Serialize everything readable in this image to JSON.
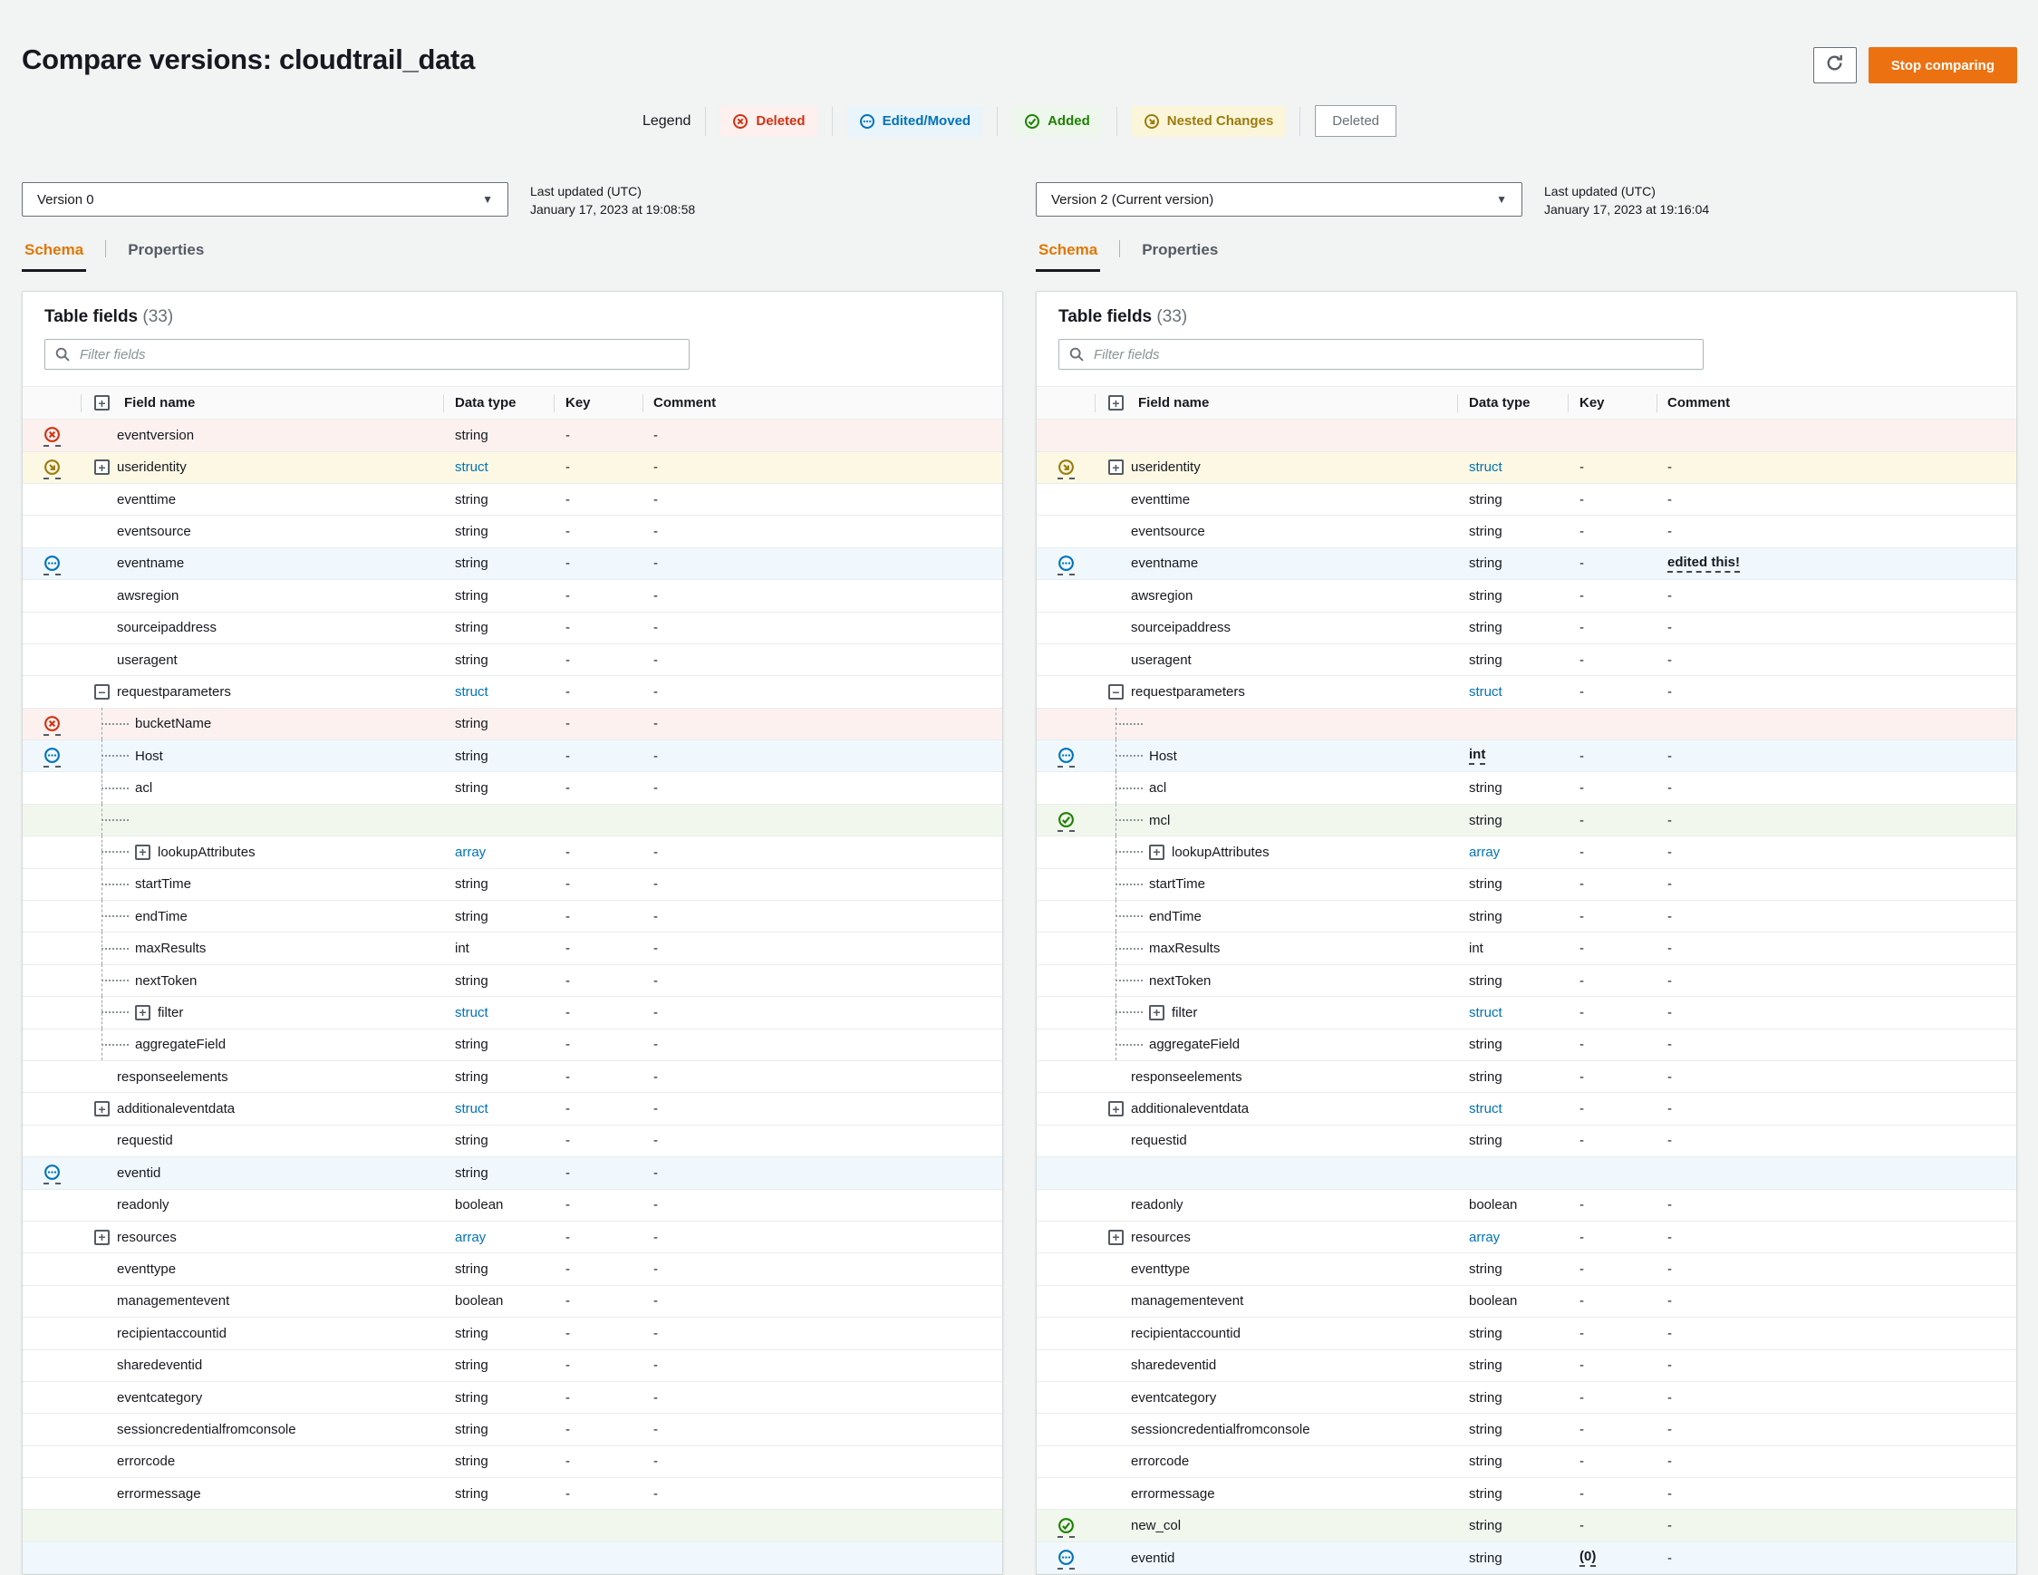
{
  "page": {
    "title": "Compare versions: cloudtrail_data"
  },
  "toolbar": {
    "stop_label": "Stop comparing",
    "refresh_icon": "refresh-icon"
  },
  "legend": {
    "label": "Legend",
    "items": [
      {
        "label": "Deleted",
        "style": "deleted"
      },
      {
        "label": "Edited/Moved",
        "style": "edited"
      },
      {
        "label": "Added",
        "style": "added"
      },
      {
        "label": "Nested Changes",
        "style": "nested"
      },
      {
        "label": "Deleted",
        "style": "plain"
      }
    ]
  },
  "colors": {
    "accent_orange": "#ec7211",
    "deleted_red": "#d13212",
    "edited_blue": "#0073bb",
    "added_green": "#1d8102",
    "nested_gold": "#9c7b0e",
    "deleted_row_bg": "#fdf1ef",
    "edited_row_bg": "#f0f8fd",
    "added_row_bg": "#f1f7ed",
    "nested_row_bg": "#fcf8e3"
  },
  "panels": [
    {
      "version": "Version 0",
      "last_updated_label": "Last updated (UTC)",
      "last_updated": "January 17, 2023 at 19:08:58",
      "tabs": [
        {
          "label": "Schema",
          "active": true
        },
        {
          "label": "Properties",
          "active": false
        }
      ],
      "table_title": "Table fields",
      "table_count": "(33)",
      "filter_placeholder": "Filter fields",
      "columns": [
        "Field name",
        "Data type",
        "Key",
        "Comment"
      ],
      "rows": [
        {
          "name": "eventversion",
          "type": "string",
          "key": "-",
          "comment": "-",
          "status": "deleted",
          "highlight": "red"
        },
        {
          "name": "useridentity",
          "type": "struct",
          "typeLink": true,
          "key": "-",
          "comment": "-",
          "status": "nested",
          "highlight": "yellow",
          "expander": "plus"
        },
        {
          "name": "eventtime",
          "type": "string",
          "key": "-",
          "comment": "-"
        },
        {
          "name": "eventsource",
          "type": "string",
          "key": "-",
          "comment": "-"
        },
        {
          "name": "eventname",
          "type": "string",
          "key": "-",
          "comment": "-",
          "status": "edited",
          "highlight": "blue"
        },
        {
          "name": "awsregion",
          "type": "string",
          "key": "-",
          "comment": "-"
        },
        {
          "name": "sourceipaddress",
          "type": "string",
          "key": "-",
          "comment": "-"
        },
        {
          "name": "useragent",
          "type": "string",
          "key": "-",
          "comment": "-"
        },
        {
          "name": "requestparameters",
          "type": "struct",
          "typeLink": true,
          "key": "-",
          "comment": "-",
          "expander": "minus"
        },
        {
          "name": "bucketName",
          "type": "string",
          "key": "-",
          "comment": "-",
          "status": "deleted",
          "highlight": "red",
          "child": true
        },
        {
          "name": "Host",
          "type": "string",
          "key": "-",
          "comment": "-",
          "status": "edited",
          "highlight": "blue",
          "child": true
        },
        {
          "name": "acl",
          "type": "string",
          "key": "-",
          "comment": "-",
          "child": true
        },
        {
          "highlight": "green",
          "child": true,
          "placeholder": true
        },
        {
          "name": "lookupAttributes",
          "type": "array",
          "typeLink": true,
          "key": "-",
          "comment": "-",
          "child": true,
          "expander": "plus"
        },
        {
          "name": "startTime",
          "type": "string",
          "key": "-",
          "comment": "-",
          "child": true
        },
        {
          "name": "endTime",
          "type": "string",
          "key": "-",
          "comment": "-",
          "child": true
        },
        {
          "name": "maxResults",
          "type": "int",
          "key": "-",
          "comment": "-",
          "child": true
        },
        {
          "name": "nextToken",
          "type": "string",
          "key": "-",
          "comment": "-",
          "child": true
        },
        {
          "name": "filter",
          "type": "struct",
          "typeLink": true,
          "key": "-",
          "comment": "-",
          "child": true,
          "expander": "plus"
        },
        {
          "name": "aggregateField",
          "type": "string",
          "key": "-",
          "comment": "-",
          "child": true
        },
        {
          "name": "responseelements",
          "type": "string",
          "key": "-",
          "comment": "-"
        },
        {
          "name": "additionaleventdata",
          "type": "struct",
          "typeLink": true,
          "key": "-",
          "comment": "-",
          "expander": "plus"
        },
        {
          "name": "requestid",
          "type": "string",
          "key": "-",
          "comment": "-"
        },
        {
          "name": "eventid",
          "type": "string",
          "key": "-",
          "comment": "-",
          "status": "edited",
          "highlight": "blue"
        },
        {
          "name": "readonly",
          "type": "boolean",
          "key": "-",
          "comment": "-"
        },
        {
          "name": "resources",
          "type": "array",
          "typeLink": true,
          "key": "-",
          "comment": "-",
          "expander": "plus"
        },
        {
          "name": "eventtype",
          "type": "string",
          "key": "-",
          "comment": "-"
        },
        {
          "name": "managementevent",
          "type": "boolean",
          "key": "-",
          "comment": "-"
        },
        {
          "name": "recipientaccountid",
          "type": "string",
          "key": "-",
          "comment": "-"
        },
        {
          "name": "sharedeventid",
          "type": "string",
          "key": "-",
          "comment": "-"
        },
        {
          "name": "eventcategory",
          "type": "string",
          "key": "-",
          "comment": "-"
        },
        {
          "name": "sessioncredentialfromconsole",
          "type": "string",
          "key": "-",
          "comment": "-"
        },
        {
          "name": "errorcode",
          "type": "string",
          "key": "-",
          "comment": "-"
        },
        {
          "name": "errormessage",
          "type": "string",
          "key": "-",
          "comment": "-"
        },
        {
          "highlight": "green",
          "placeholder": true
        },
        {
          "highlight": "blue",
          "placeholder": true
        }
      ]
    },
    {
      "version": "Version 2 (Current version)",
      "last_updated_label": "Last updated (UTC)",
      "last_updated": "January 17, 2023 at 19:16:04",
      "tabs": [
        {
          "label": "Schema",
          "active": true
        },
        {
          "label": "Properties",
          "active": false
        }
      ],
      "table_title": "Table fields",
      "table_count": "(33)",
      "filter_placeholder": "Filter fields",
      "columns": [
        "Field name",
        "Data type",
        "Key",
        "Comment"
      ],
      "rows": [
        {
          "highlight": "red",
          "placeholder": true
        },
        {
          "name": "useridentity",
          "type": "struct",
          "typeLink": true,
          "key": "-",
          "comment": "-",
          "status": "nested",
          "highlight": "yellow",
          "expander": "plus"
        },
        {
          "name": "eventtime",
          "type": "string",
          "key": "-",
          "comment": "-"
        },
        {
          "name": "eventsource",
          "type": "string",
          "key": "-",
          "comment": "-"
        },
        {
          "name": "eventname",
          "type": "string",
          "key": "-",
          "comment": "edited this!",
          "comment_emph": true,
          "status": "edited",
          "highlight": "blue"
        },
        {
          "name": "awsregion",
          "type": "string",
          "key": "-",
          "comment": "-"
        },
        {
          "name": "sourceipaddress",
          "type": "string",
          "key": "-",
          "comment": "-"
        },
        {
          "name": "useragent",
          "type": "string",
          "key": "-",
          "comment": "-"
        },
        {
          "name": "requestparameters",
          "type": "struct",
          "typeLink": true,
          "key": "-",
          "comment": "-",
          "expander": "minus"
        },
        {
          "highlight": "red",
          "child": true,
          "placeholder": true
        },
        {
          "name": "Host",
          "type": "int",
          "type_emph": true,
          "key": "-",
          "comment": "-",
          "status": "edited",
          "highlight": "blue",
          "child": true
        },
        {
          "name": "acl",
          "type": "string",
          "key": "-",
          "comment": "-",
          "child": true
        },
        {
          "name": "mcl",
          "type": "string",
          "key": "-",
          "comment": "-",
          "status": "added",
          "highlight": "green",
          "child": true
        },
        {
          "name": "lookupAttributes",
          "type": "array",
          "typeLink": true,
          "key": "-",
          "comment": "-",
          "child": true,
          "expander": "plus"
        },
        {
          "name": "startTime",
          "type": "string",
          "key": "-",
          "comment": "-",
          "child": true
        },
        {
          "name": "endTime",
          "type": "string",
          "key": "-",
          "comment": "-",
          "child": true
        },
        {
          "name": "maxResults",
          "type": "int",
          "key": "-",
          "comment": "-",
          "child": true
        },
        {
          "name": "nextToken",
          "type": "string",
          "key": "-",
          "comment": "-",
          "child": true
        },
        {
          "name": "filter",
          "type": "struct",
          "typeLink": true,
          "key": "-",
          "comment": "-",
          "child": true,
          "expander": "plus"
        },
        {
          "name": "aggregateField",
          "type": "string",
          "key": "-",
          "comment": "-",
          "child": true
        },
        {
          "name": "responseelements",
          "type": "string",
          "key": "-",
          "comment": "-"
        },
        {
          "name": "additionaleventdata",
          "type": "struct",
          "typeLink": true,
          "key": "-",
          "comment": "-",
          "expander": "plus"
        },
        {
          "name": "requestid",
          "type": "string",
          "key": "-",
          "comment": "-"
        },
        {
          "highlight": "blue",
          "placeholder": true
        },
        {
          "name": "readonly",
          "type": "boolean",
          "key": "-",
          "comment": "-"
        },
        {
          "name": "resources",
          "type": "array",
          "typeLink": true,
          "key": "-",
          "comment": "-",
          "expander": "plus"
        },
        {
          "name": "eventtype",
          "type": "string",
          "key": "-",
          "comment": "-"
        },
        {
          "name": "managementevent",
          "type": "boolean",
          "key": "-",
          "comment": "-"
        },
        {
          "name": "recipientaccountid",
          "type": "string",
          "key": "-",
          "comment": "-"
        },
        {
          "name": "sharedeventid",
          "type": "string",
          "key": "-",
          "comment": "-"
        },
        {
          "name": "eventcategory",
          "type": "string",
          "key": "-",
          "comment": "-"
        },
        {
          "name": "sessioncredentialfromconsole",
          "type": "string",
          "key": "-",
          "comment": "-"
        },
        {
          "name": "errorcode",
          "type": "string",
          "key": "-",
          "comment": "-"
        },
        {
          "name": "errormessage",
          "type": "string",
          "key": "-",
          "comment": "-"
        },
        {
          "name": "new_col",
          "type": "string",
          "key": "-",
          "comment": "-",
          "status": "added",
          "highlight": "green"
        },
        {
          "name": "eventid",
          "type": "string",
          "key": "(0)",
          "key_emph": true,
          "comment": "-",
          "status": "edited",
          "highlight": "blue"
        }
      ]
    }
  ]
}
